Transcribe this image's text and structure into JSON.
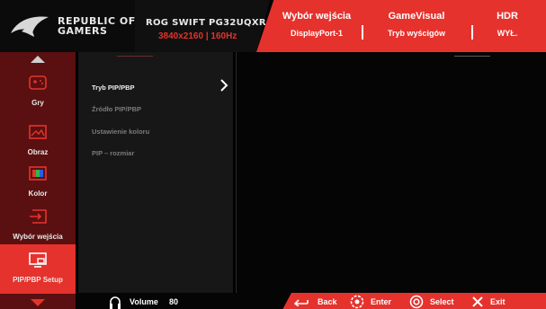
{
  "header": {
    "brand_line1": "REPUBLIC OF",
    "brand_line2": "GAMERS",
    "model": "ROG SWIFT PG32UQXR",
    "resolution": "3840x2160 | 160Hz",
    "info": [
      {
        "title": "Wybór wejścia",
        "value": "DisplayPort-1"
      },
      {
        "title": "GameVisual",
        "value": "Tryb wyścigów"
      },
      {
        "title": "HDR",
        "value": "WYŁ."
      }
    ]
  },
  "nav": {
    "items": [
      {
        "label": "Gry",
        "icon": "gamepad-icon"
      },
      {
        "label": "Obraz",
        "icon": "image-icon"
      },
      {
        "label": "Kolor",
        "icon": "color-icon"
      },
      {
        "label": "Wybór wejścia",
        "icon": "input-select-icon"
      },
      {
        "label": "PIP/PBP Setup",
        "icon": "pip-icon"
      }
    ],
    "active_index": 4
  },
  "menu": {
    "items": [
      {
        "label": "Tryb PIP/PBP",
        "enabled": true
      },
      {
        "label": "Źródło PIP/PBP",
        "enabled": false
      },
      {
        "label": "Ustawienie koloru",
        "enabled": false
      },
      {
        "label": "PIP – rozmiar",
        "enabled": false
      }
    ]
  },
  "footer": {
    "volume_label": "Volume",
    "volume_value": "80",
    "back_label": "Back",
    "enter_label": "Enter",
    "select_label": "Select",
    "exit_label": "Exit"
  },
  "colors": {
    "accent": "#e5322d",
    "nav_bg": "#5a1010",
    "panel_bg": "#171717"
  }
}
